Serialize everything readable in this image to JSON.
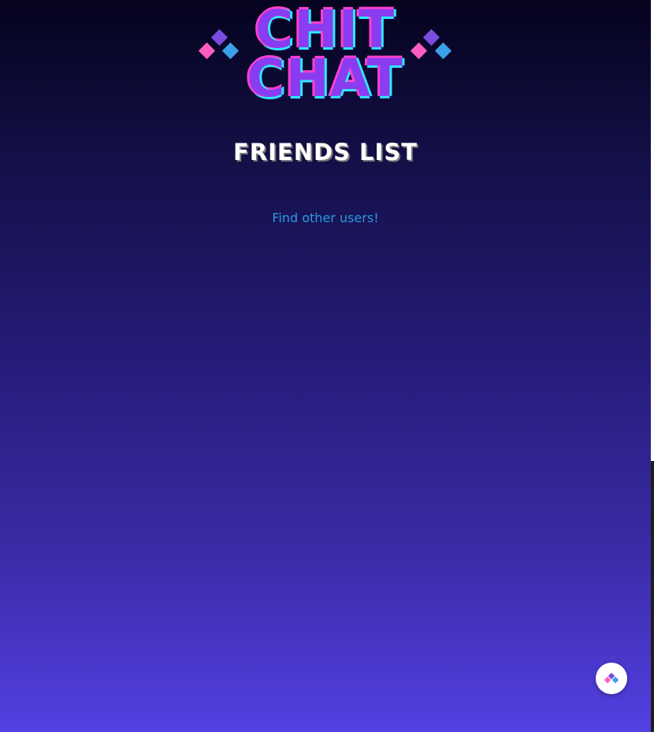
{
  "logo": {
    "lines": [
      "CHIT",
      "CHAT"
    ],
    "colors": {
      "fill": "#8a3cf0",
      "pink": "#ff3fd0",
      "cyan": "#2ee8ff"
    },
    "diamond_colors": {
      "purple": "#7a4ce0",
      "pink": "#ff5cc0",
      "blue": "#3aa0e8"
    }
  },
  "page": {
    "title": "FRIENDS LIST",
    "find_users_link": "Find other users!"
  },
  "fab": {
    "icon": "chit-chat-diamonds-icon"
  },
  "colors": {
    "link": "#2b9ae0",
    "background_top": "#05031e",
    "background_bottom": "#5340e2"
  }
}
